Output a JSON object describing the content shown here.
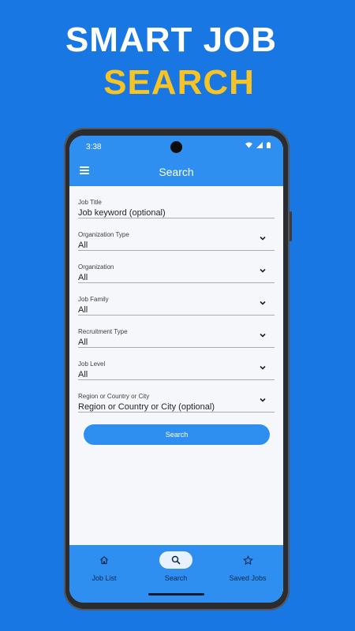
{
  "promo": {
    "line1": "SMART JOB",
    "line2": "SEARCH",
    "line1_color": "#ffffff",
    "line2_color": "#f7c325",
    "background_color": "#1877e3"
  },
  "status_bar": {
    "time": "3:38",
    "icons": [
      "wifi-icon",
      "signal-icon",
      "battery-icon"
    ]
  },
  "app_bar": {
    "title": "Search",
    "menu_icon": "menu-icon",
    "color": "#2e8ff0"
  },
  "form": {
    "fields": [
      {
        "label": "Job Title",
        "value": "Job keyword (optional)",
        "dropdown": false
      },
      {
        "label": "Organization Type",
        "value": "All",
        "dropdown": true
      },
      {
        "label": "Organization",
        "value": "All",
        "dropdown": true
      },
      {
        "label": "Job Family",
        "value": "All",
        "dropdown": true
      },
      {
        "label": "Recruitment Type",
        "value": "All",
        "dropdown": true
      },
      {
        "label": "Job Level",
        "value": "All",
        "dropdown": true
      },
      {
        "label": "Region or Country or City",
        "value": "Region or Country or City (optional)",
        "dropdown": true
      }
    ],
    "search_button_label": "Search"
  },
  "bottom_nav": {
    "items": [
      {
        "label": "Job List",
        "icon": "home-icon",
        "active": false
      },
      {
        "label": "Search",
        "icon": "search-icon",
        "active": true
      },
      {
        "label": "Saved Jobs",
        "icon": "star-icon",
        "active": false
      }
    ]
  }
}
